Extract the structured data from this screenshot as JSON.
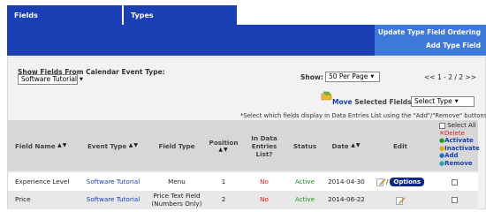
{
  "tabs": [
    {
      "label": "Fields"
    },
    {
      "label": "Types"
    }
  ],
  "banner": {
    "links": [
      "Update Type Field Ordering",
      "Add Type Field"
    ]
  },
  "filter": {
    "label": "Show Fields From Calendar Event Type:",
    "selected": "Software Tutorial"
  },
  "pagination": {
    "show_label": "Show:",
    "per_page": "50 Per Page",
    "pager": "<< 1 - 2 / 2 >>"
  },
  "move": {
    "label_strong": "Move",
    "label_rest": " Selected Fields To:",
    "select_value": "Select Type"
  },
  "instructions": "*Select which fields display in Data Entries List using the \"Add\"/\"Remove\" buttons.",
  "columns": [
    "Field Name",
    "Event Type",
    "Field Type",
    "Position",
    "In Data Entries List?",
    "Status",
    "Date",
    "Edit"
  ],
  "sort_glyph": "▲▼",
  "select_all": {
    "label": "Select All",
    "delete": "Delete",
    "activate": "Activate",
    "inactivate": "Inactivate",
    "add": "Add",
    "remove": "Remove"
  },
  "rows": [
    {
      "field_name": "Experience Level",
      "event_type": "Software Tutorial",
      "field_type": "Menu",
      "position": "1",
      "in_list": "No",
      "status": "Active",
      "date": "2014-04-30",
      "edit_sep": "/",
      "options": "Options"
    },
    {
      "field_name": "Price",
      "event_type": "Software Tutorial",
      "field_type": "Price Text Field (Numbers Only)",
      "position": "2",
      "in_list": "No",
      "status": "Active",
      "date": "2014-06-22"
    }
  ]
}
